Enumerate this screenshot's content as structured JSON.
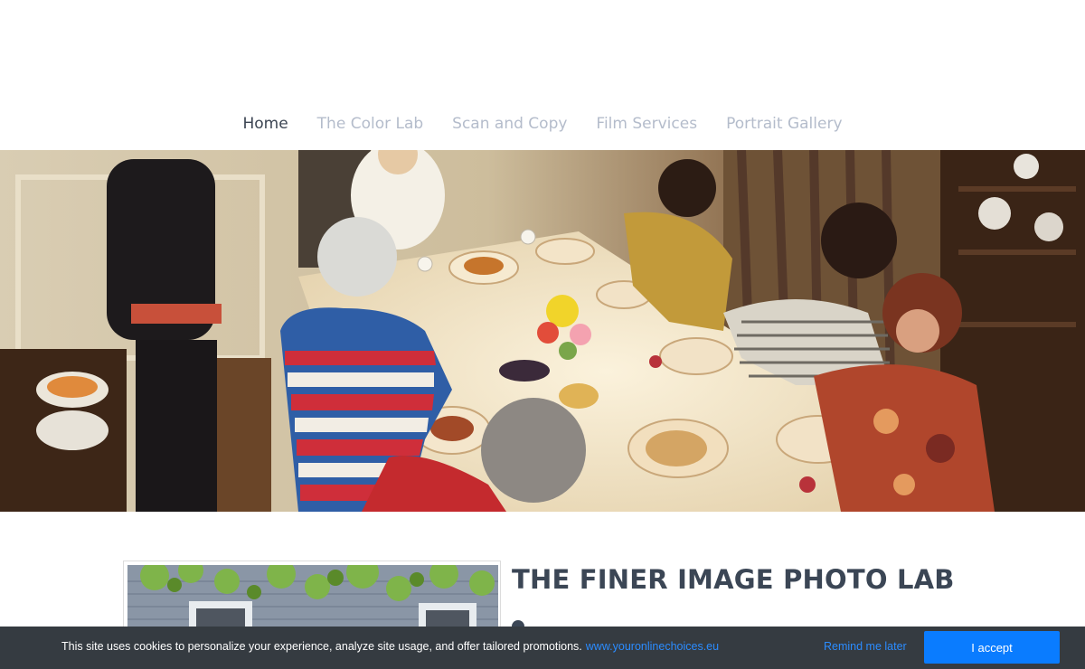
{
  "nav": {
    "items": [
      {
        "label": "Home",
        "active": true
      },
      {
        "label": "The Color Lab",
        "active": false
      },
      {
        "label": "Scan and Copy",
        "active": false
      },
      {
        "label": "Film Services",
        "active": false
      },
      {
        "label": "Portrait Gallery",
        "active": false
      }
    ]
  },
  "hero": {
    "alt": "Family gathered around a dinner table"
  },
  "content": {
    "title": "THE FINER IMAGE PHOTO LAB"
  },
  "cookie_banner": {
    "message": "This site uses cookies to personalize your experience, analyze site usage, and offer tailored promotions.",
    "link_text": "www.youronlinechoices.eu",
    "remind_label": "Remind me later",
    "accept_label": "I accept"
  },
  "colors": {
    "nav_active": "#3c4553",
    "nav_inactive": "#b4bccb",
    "banner_bg": "#353b41",
    "accent": "#0a7cff",
    "link": "#2b8cff"
  }
}
